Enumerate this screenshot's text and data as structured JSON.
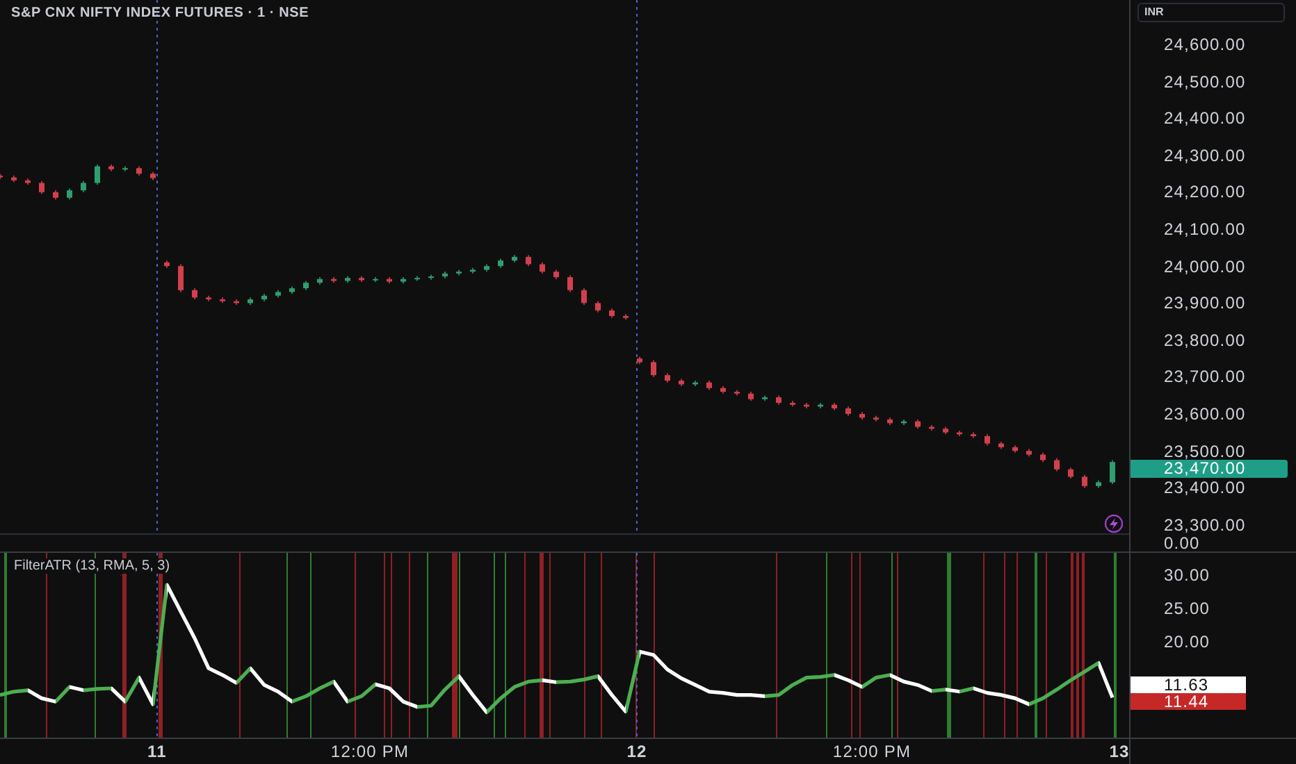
{
  "chart": {
    "title": "S&P CNX NIFTY INDEX FUTURES · 1 · NSE",
    "currency": "INR",
    "chart_data": {
      "type": "candlestick",
      "ylim": [
        23273,
        24720
      ],
      "yticks": [
        {
          "value": 24600,
          "label": "24,600.00"
        },
        {
          "value": 24500,
          "label": "24,500.00"
        },
        {
          "value": 24400,
          "label": "24,400.00"
        },
        {
          "value": 24300,
          "label": "24,300.00"
        },
        {
          "value": 24200,
          "label": "24,200.00"
        },
        {
          "value": 24100,
          "label": "24,100.00"
        },
        {
          "value": 24000,
          "label": "24,000.00"
        },
        {
          "value": 23900,
          "label": "23,900.00"
        },
        {
          "value": 23800,
          "label": "23,800.00"
        },
        {
          "value": 23700,
          "label": "23,700.00"
        },
        {
          "value": 23600,
          "label": "23,600.00"
        },
        {
          "value": 23500,
          "label": "23,500.00"
        },
        {
          "value": 23400,
          "label": "23,400.00"
        },
        {
          "value": 23300,
          "label": "23,300.00"
        }
      ],
      "categories": [
        null,
        null,
        null,
        null,
        null,
        null,
        null,
        null,
        null,
        null,
        null,
        null,
        null,
        null,
        null,
        null,
        null,
        null,
        null,
        null,
        null,
        null,
        null,
        null,
        null,
        null,
        null,
        null,
        null,
        null,
        null,
        null,
        null,
        null,
        null,
        null,
        null,
        null,
        null,
        null,
        null,
        null,
        null,
        null,
        null,
        null,
        null,
        null,
        null,
        null,
        null,
        null,
        null,
        null,
        null,
        null,
        null,
        null,
        null,
        null,
        null,
        null,
        null,
        null,
        null,
        null,
        null,
        null,
        null,
        null,
        null,
        null,
        null,
        null,
        null,
        null,
        null,
        null,
        null,
        null,
        null
      ],
      "ohlc": [
        [
          24245,
          24250,
          24235,
          24240
        ],
        [
          24240,
          24245,
          24227,
          24232
        ],
        [
          24232,
          24237,
          24220,
          24225
        ],
        [
          24225,
          24230,
          24195,
          24200
        ],
        [
          24200,
          24205,
          24180,
          24185
        ],
        [
          24185,
          24210,
          24180,
          24205
        ],
        [
          24205,
          24230,
          24200,
          24225
        ],
        [
          24225,
          24275,
          24220,
          24270
        ],
        [
          24270,
          24275,
          24257,
          24262
        ],
        [
          24262,
          24270,
          24257,
          24265
        ],
        [
          24265,
          24270,
          24245,
          24250
        ],
        [
          24250,
          24255,
          24233,
          24238
        ],
        [
          24010,
          24015,
          23995,
          24000
        ],
        [
          24000,
          24005,
          23930,
          23935
        ],
        [
          23935,
          23940,
          23910,
          23915
        ],
        [
          23915,
          23920,
          23905,
          23910
        ],
        [
          23910,
          23915,
          23900,
          23905
        ],
        [
          23905,
          23910,
          23895,
          23900
        ],
        [
          23900,
          23915,
          23895,
          23910
        ],
        [
          23910,
          23925,
          23905,
          23920
        ],
        [
          23920,
          23935,
          23915,
          23930
        ],
        [
          23930,
          23945,
          23925,
          23940
        ],
        [
          23940,
          23960,
          23935,
          23955
        ],
        [
          23955,
          23970,
          23950,
          23965
        ],
        [
          23965,
          23970,
          23955,
          23960
        ],
        [
          23960,
          23973,
          23955,
          23968
        ],
        [
          23968,
          23973,
          23957,
          23962
        ],
        [
          23962,
          23970,
          23957,
          23965
        ],
        [
          23965,
          23970,
          23953,
          23958
        ],
        [
          23958,
          23970,
          23953,
          23965
        ],
        [
          23965,
          23973,
          23960,
          23968
        ],
        [
          23968,
          23977,
          23963,
          23972
        ],
        [
          23972,
          23985,
          23967,
          23980
        ],
        [
          23980,
          23990,
          23975,
          23985
        ],
        [
          23985,
          23995,
          23980,
          23990
        ],
        [
          23990,
          24005,
          23985,
          24000
        ],
        [
          24000,
          24020,
          23995,
          24015
        ],
        [
          24015,
          24030,
          24010,
          24025
        ],
        [
          24025,
          24030,
          24000,
          24005
        ],
        [
          24005,
          24010,
          23980,
          23985
        ],
        [
          23985,
          23990,
          23965,
          23970
        ],
        [
          23970,
          23975,
          23930,
          23935
        ],
        [
          23935,
          23940,
          23895,
          23900
        ],
        [
          23900,
          23905,
          23875,
          23880
        ],
        [
          23880,
          23885,
          23860,
          23865
        ],
        [
          23865,
          23870,
          23855,
          23860
        ],
        [
          23750,
          23755,
          23735,
          23740
        ],
        [
          23740,
          23745,
          23700,
          23705
        ],
        [
          23705,
          23710,
          23685,
          23690
        ],
        [
          23690,
          23695,
          23675,
          23680
        ],
        [
          23680,
          23690,
          23675,
          23685
        ],
        [
          23685,
          23690,
          23665,
          23670
        ],
        [
          23670,
          23675,
          23655,
          23660
        ],
        [
          23660,
          23665,
          23650,
          23655
        ],
        [
          23655,
          23660,
          23635,
          23640
        ],
        [
          23640,
          23650,
          23635,
          23645
        ],
        [
          23645,
          23650,
          23625,
          23630
        ],
        [
          23630,
          23635,
          23620,
          23625
        ],
        [
          23625,
          23630,
          23615,
          23620
        ],
        [
          23620,
          23630,
          23615,
          23625
        ],
        [
          23625,
          23630,
          23610,
          23615
        ],
        [
          23615,
          23620,
          23595,
          23600
        ],
        [
          23600,
          23605,
          23585,
          23590
        ],
        [
          23590,
          23595,
          23580,
          23585
        ],
        [
          23585,
          23590,
          23570,
          23575
        ],
        [
          23575,
          23585,
          23570,
          23580
        ],
        [
          23580,
          23585,
          23560,
          23565
        ],
        [
          23565,
          23570,
          23555,
          23560
        ],
        [
          23560,
          23565,
          23545,
          23550
        ],
        [
          23550,
          23555,
          23540,
          23545
        ],
        [
          23545,
          23550,
          23535,
          23540
        ],
        [
          23540,
          23545,
          23515,
          23520
        ],
        [
          23520,
          23525,
          23505,
          23510
        ],
        [
          23510,
          23515,
          23495,
          23500
        ],
        [
          23500,
          23505,
          23485,
          23490
        ],
        [
          23490,
          23495,
          23470,
          23475
        ],
        [
          23475,
          23480,
          23445,
          23450
        ],
        [
          23450,
          23455,
          23425,
          23430
        ],
        [
          23430,
          23435,
          23400,
          23405
        ],
        [
          23405,
          23420,
          23400,
          23415
        ],
        [
          23415,
          23475,
          23410,
          23470
        ]
      ]
    },
    "last_price": {
      "text": "23,470.00",
      "color": "#1e9e86"
    }
  },
  "pane_axis": "0.00",
  "indicator": {
    "title": "FilterATR (13, RMA, 5, 3)",
    "chart_data": {
      "type": "line",
      "ylim": [
        5.6,
        33.3
      ],
      "categories": [
        null,
        null,
        null,
        null,
        null,
        null,
        null,
        null,
        null,
        null,
        null,
        null,
        null,
        null,
        null,
        null,
        null,
        null,
        null,
        null,
        null,
        null,
        null,
        null,
        null,
        null,
        null,
        null,
        null,
        null,
        null,
        null,
        null,
        null,
        null,
        null,
        null,
        null,
        null,
        null,
        null,
        null,
        null,
        null,
        null,
        null,
        null,
        null,
        null,
        null,
        null,
        null,
        null,
        null,
        null,
        null,
        null,
        null,
        null,
        null,
        null,
        null,
        null,
        null,
        null,
        null,
        null,
        null,
        null,
        null,
        null,
        null,
        null,
        null,
        null,
        null,
        null,
        null,
        null,
        null,
        null
      ],
      "yticks": [
        {
          "value": 30,
          "label": "30.00"
        },
        {
          "value": 25,
          "label": "25.00"
        },
        {
          "value": 20,
          "label": "20.00"
        }
      ],
      "series": [
        {
          "color": "#ffffff",
          "values": [
            12.0,
            12.5,
            12.7,
            11.5,
            11.0,
            13.2,
            12.7,
            12.9,
            13.0,
            11.0,
            14.6,
            10.6,
            28.5,
            24.5,
            20.5,
            16.0,
            15.0,
            13.8,
            16.0,
            13.5,
            12.5,
            11.0,
            11.8,
            13.0,
            14.0,
            11.0,
            11.8,
            13.6,
            13.0,
            11.0,
            10.2,
            10.4,
            12.8,
            14.8,
            12.0,
            9.4,
            11.5,
            13.2,
            14.0,
            14.2,
            13.9,
            14.0,
            14.3,
            14.8,
            12.0,
            9.5,
            18.5,
            18.0,
            15.8,
            14.5,
            13.5,
            12.5,
            12.3,
            12.0,
            12.0,
            11.8,
            12.0,
            13.5,
            14.6,
            14.7,
            15.0,
            14.2,
            13.2,
            14.6,
            15.0,
            14.0,
            13.5,
            12.6,
            12.8,
            12.5,
            13.0,
            12.3,
            12.0,
            11.5,
            10.6,
            11.5,
            12.8,
            14.2,
            15.5,
            16.8,
            11.6
          ]
        }
      ]
    },
    "values": [
      {
        "text": "11.63",
        "color": "#ffffff"
      },
      {
        "text": "11.44",
        "color": "#c62828"
      }
    ]
  },
  "time_axis": [
    {
      "text": "11",
      "kind": "day"
    },
    {
      "text": "12:00 PM",
      "kind": "time"
    },
    {
      "text": "12",
      "kind": "day"
    },
    {
      "text": "12:00 PM",
      "kind": "time"
    },
    {
      "text": "13",
      "kind": "day"
    }
  ]
}
